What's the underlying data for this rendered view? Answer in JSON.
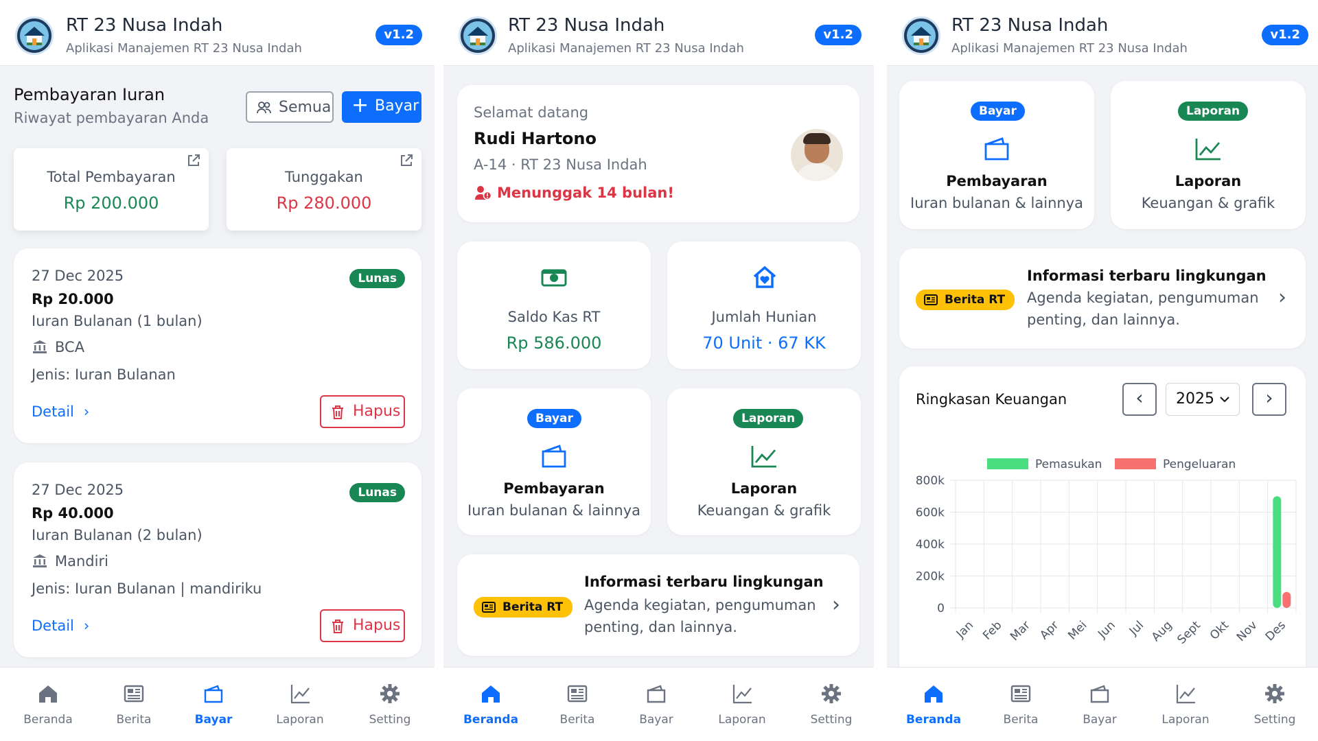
{
  "app": {
    "title": "RT 23 Nusa Indah",
    "subtitle": "Aplikasi Manajemen RT 23 Nusa Indah",
    "version": "v1.2"
  },
  "nav": [
    {
      "label": "Beranda",
      "icon": "home-icon"
    },
    {
      "label": "Berita",
      "icon": "newspaper-icon"
    },
    {
      "label": "Bayar",
      "icon": "wallet-icon"
    },
    {
      "label": "Laporan",
      "icon": "chart-line-icon"
    },
    {
      "label": "Setting",
      "icon": "gear-icon"
    }
  ],
  "payments": {
    "title": "Pembayaran Iuran",
    "subtitle": "Riwayat pembayaran Anda",
    "filter_label": "Semua",
    "pay_label": "Bayar",
    "total_label": "Total Pembayaran",
    "total_value": "Rp 200.000",
    "arrears_label": "Tunggakan",
    "arrears_value": "Rp 280.000",
    "items": [
      {
        "date": "27 Dec 2025",
        "amount": "Rp 20.000",
        "desc": "Iuran Bulanan (1 bulan)",
        "bank": "BCA",
        "type": "Jenis: Iuran Bulanan",
        "status": "Lunas",
        "detail": "Detail",
        "delete": "Hapus"
      },
      {
        "date": "27 Dec 2025",
        "amount": "Rp 40.000",
        "desc": "Iuran Bulanan (2 bulan)",
        "bank": "Mandiri",
        "type": "Jenis: Iuran Bulanan | mandiriku",
        "status": "Lunas",
        "detail": "Detail",
        "delete": "Hapus"
      }
    ]
  },
  "home": {
    "welcome": "Selamat datang",
    "name": "Rudi Hartono",
    "address": "A-14 · RT 23 Nusa Indah",
    "alert": "Menunggak 14 bulan!",
    "stats": [
      {
        "label": "Saldo Kas RT",
        "value": "Rp 586.000",
        "icon": "cash-icon"
      },
      {
        "label": "Jumlah Hunian",
        "value": "70 Unit · 67 KK",
        "icon": "house-heart-icon"
      }
    ],
    "tiles": [
      {
        "badge": "Bayar",
        "title": "Pembayaran",
        "desc": "Iuran bulanan & lainnya"
      },
      {
        "badge": "Laporan",
        "title": "Laporan",
        "desc": "Keuangan & grafik"
      }
    ],
    "news": {
      "badge": "Berita RT",
      "title": "Informasi terbaru lingkungan",
      "desc_line1": "Agenda kegiatan, pengumuman",
      "desc_line2": "penting, dan lainnya."
    }
  },
  "finance": {
    "title": "Ringkasan Keuangan",
    "year": "2025"
  },
  "colors": {
    "primary": "#0d6efd",
    "success": "#198754",
    "danger": "#dc3545",
    "warning": "#ffc107",
    "income": "#4ade80",
    "expense": "#f87171"
  },
  "chart_data": {
    "type": "bar",
    "categories": [
      "Jan",
      "Feb",
      "Mar",
      "Apr",
      "Mei",
      "Jun",
      "Jul",
      "Aug",
      "Sept",
      "Okt",
      "Nov",
      "Des"
    ],
    "series": [
      {
        "name": "Pemasukan",
        "values": [
          0,
          0,
          0,
          0,
          0,
          0,
          0,
          0,
          0,
          0,
          0,
          700000
        ]
      },
      {
        "name": "Pengeluaran",
        "values": [
          0,
          0,
          0,
          0,
          0,
          0,
          0,
          0,
          0,
          0,
          0,
          100000
        ]
      }
    ],
    "ytick_labels": [
      "800k",
      "600k",
      "400k",
      "200k",
      "0"
    ],
    "ylim": [
      0,
      800000
    ],
    "grid": true,
    "legend": "top"
  }
}
